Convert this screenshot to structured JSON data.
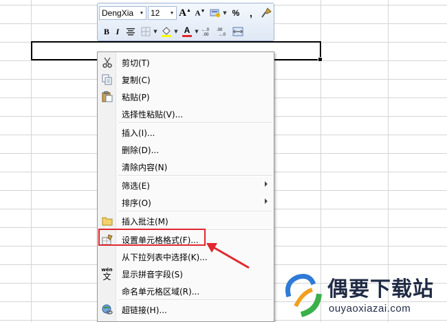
{
  "toolbar": {
    "font_name": "DengXia",
    "font_size": "12",
    "grow_font": "A",
    "shrink_font": "A",
    "percent": "%",
    "comma": ",",
    "bold": "B",
    "italic": "I",
    "font_color_label": "A",
    "increase_decimal": ".0→.00",
    "decrease_decimal": ".00→.0"
  },
  "menu": {
    "items": [
      {
        "label": "剪切(T)",
        "icon": "scissors-icon"
      },
      {
        "label": "复制(C)",
        "icon": "copy-icon"
      },
      {
        "label": "粘贴(P)",
        "icon": "paste-icon"
      },
      {
        "label": "选择性粘贴(V)...",
        "icon": ""
      },
      {
        "label": "插入(I)...",
        "icon": ""
      },
      {
        "label": "删除(D)...",
        "icon": ""
      },
      {
        "label": "清除内容(N)",
        "icon": ""
      },
      {
        "label": "筛选(E)",
        "icon": "",
        "submenu": true
      },
      {
        "label": "排序(O)",
        "icon": "",
        "submenu": true
      },
      {
        "label": "插入批注(M)",
        "icon": "comment-icon"
      },
      {
        "label": "设置单元格格式(F)...",
        "icon": "format-cells-icon"
      },
      {
        "label": "从下拉列表中选择(K)...",
        "icon": ""
      },
      {
        "label": "显示拼音字段(S)",
        "icon": "phonetic-icon"
      },
      {
        "label": "命名单元格区域(R)...",
        "icon": ""
      },
      {
        "label": "超链接(H)...",
        "icon": "hyperlink-icon"
      }
    ]
  },
  "phonetic_icon_text": "wén",
  "phonetic_icon_char": "文",
  "watermark": {
    "title": "偶要下载站",
    "url": "ouyaoxiazai.com"
  },
  "colors": {
    "highlight": "#e0272d",
    "arrow": "#e0272d",
    "font_color_bar": "#e0272d",
    "fill_color_bar": "#ffff00"
  }
}
